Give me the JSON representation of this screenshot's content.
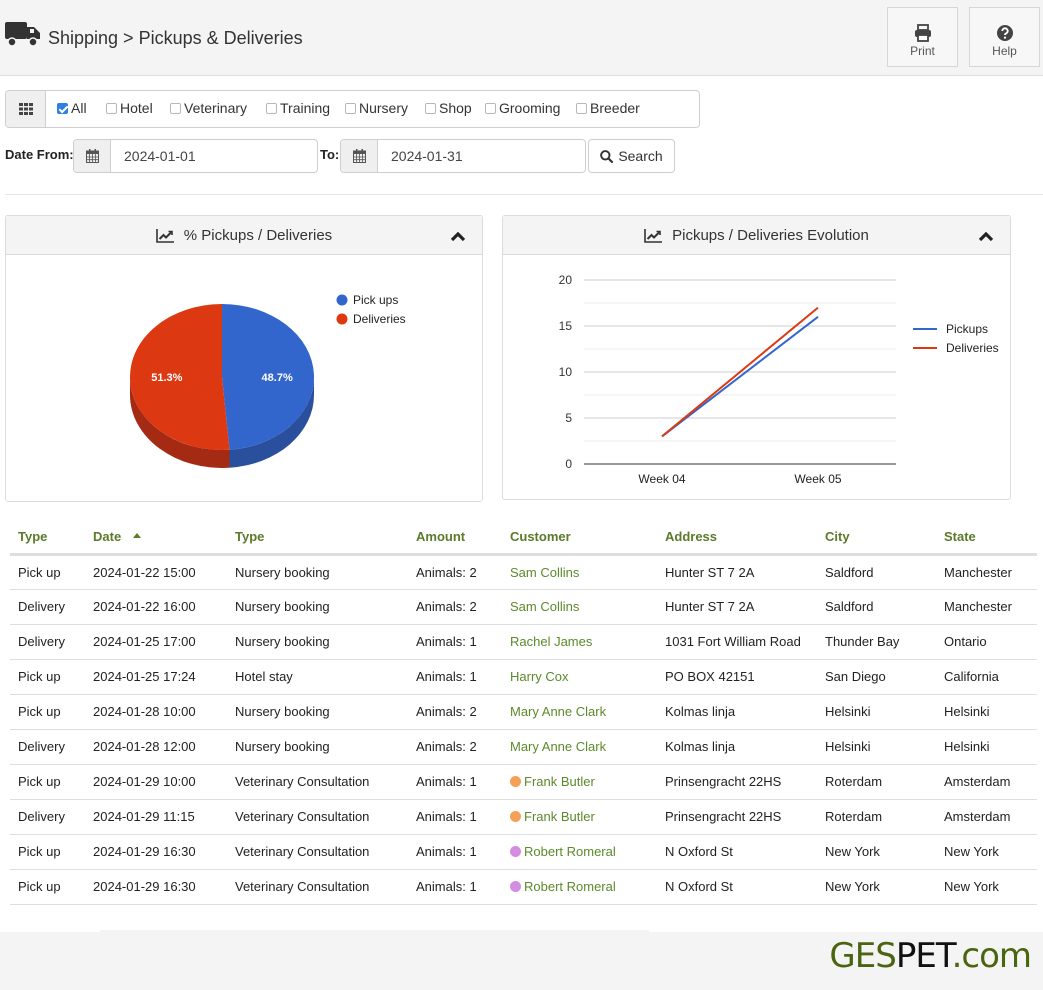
{
  "header": {
    "breadcrumb": "Shipping > Pickups & Deliveries",
    "icon": "truck-icon",
    "buttons": [
      {
        "label": "Print",
        "icon": "print-icon"
      },
      {
        "label": "Help",
        "icon": "question-circle-icon"
      }
    ]
  },
  "filters": {
    "categories": [
      {
        "label": "All",
        "checked": true
      },
      {
        "label": "Hotel",
        "checked": false
      },
      {
        "label": "Veterinary",
        "checked": false
      },
      {
        "label": "Training",
        "checked": false
      },
      {
        "label": "Nursery",
        "checked": false
      },
      {
        "label": "Shop",
        "checked": false
      },
      {
        "label": "Grooming",
        "checked": false
      },
      {
        "label": "Breeder",
        "checked": false
      }
    ],
    "date_from_label": "Date From:",
    "date_from": "2024-01-01",
    "date_to_label": "To:",
    "date_to": "2024-01-31",
    "search_label": "Search"
  },
  "colors": {
    "pickups": "#3366cc",
    "deliveries": "#dc3912",
    "header_green": "#5b7a2a",
    "link_green": "#5b8a2a"
  },
  "chart_data": [
    {
      "type": "pie",
      "title": "% Pickups / Deliveries",
      "labels": [
        "Pick ups",
        "Deliveries"
      ],
      "values": [
        48.7,
        51.3
      ],
      "data_labels": [
        "48.7%",
        "51.3%"
      ],
      "legend": "right"
    },
    {
      "type": "line",
      "title": "Pickups / Deliveries Evolution",
      "categories": [
        "Week 04",
        "Week 05"
      ],
      "series": [
        {
          "name": "Pickups",
          "values": [
            3,
            16
          ]
        },
        {
          "name": "Deliveries",
          "values": [
            3,
            17
          ]
        }
      ],
      "ylim": [
        0,
        20
      ],
      "yticks": [
        0,
        5,
        10,
        15,
        20
      ],
      "grid": true,
      "legend": "right"
    }
  ],
  "table": {
    "columns": [
      "Type",
      "Date",
      "Type",
      "Amount",
      "Customer",
      "Address",
      "City",
      "State"
    ],
    "sorted_column": "Date",
    "rows": [
      {
        "kind": "Pick up",
        "date": "2024-01-22 15:00",
        "service": "Nursery booking",
        "amount": "Animals: 2",
        "customer": "Sam Collins",
        "dot": "",
        "address": "Hunter ST 7 2A",
        "city": "Saldford",
        "state": "Manchester"
      },
      {
        "kind": "Delivery",
        "date": "2024-01-22 16:00",
        "service": "Nursery booking",
        "amount": "Animals: 2",
        "customer": "Sam Collins",
        "dot": "",
        "address": "Hunter ST 7 2A",
        "city": "Saldford",
        "state": "Manchester"
      },
      {
        "kind": "Delivery",
        "date": "2024-01-25 17:00",
        "service": "Nursery booking",
        "amount": "Animals: 1",
        "customer": "Rachel James",
        "dot": "",
        "address": "1031 Fort William Road",
        "city": "Thunder Bay",
        "state": "Ontario"
      },
      {
        "kind": "Pick up",
        "date": "2024-01-25 17:24",
        "service": "Hotel stay",
        "amount": "Animals: 1",
        "customer": "Harry Cox",
        "dot": "",
        "address": "PO BOX 42151",
        "city": "San Diego",
        "state": "California"
      },
      {
        "kind": "Pick up",
        "date": "2024-01-28 10:00",
        "service": "Nursery booking",
        "amount": "Animals: 2",
        "customer": "Mary Anne Clark",
        "dot": "",
        "address": "Kolmas linja",
        "city": "Helsinki",
        "state": "Helsinki"
      },
      {
        "kind": "Delivery",
        "date": "2024-01-28 12:00",
        "service": "Nursery booking",
        "amount": "Animals: 2",
        "customer": "Mary Anne Clark",
        "dot": "",
        "address": "Kolmas linja",
        "city": "Helsinki",
        "state": "Helsinki"
      },
      {
        "kind": "Pick up",
        "date": "2024-01-29 10:00",
        "service": "Veterinary Consultation",
        "amount": "Animals: 1",
        "customer": "Frank Butler",
        "dot": "#f4a057",
        "address": "Prinsengracht 22HS",
        "city": "Roterdam",
        "state": "Amsterdam"
      },
      {
        "kind": "Delivery",
        "date": "2024-01-29 11:15",
        "service": "Veterinary Consultation",
        "amount": "Animals: 1",
        "customer": "Frank Butler",
        "dot": "#f4a057",
        "address": "Prinsengracht 22HS",
        "city": "Roterdam",
        "state": "Amsterdam"
      },
      {
        "kind": "Pick up",
        "date": "2024-01-29 16:30",
        "service": "Veterinary Consultation",
        "amount": "Animals: 1",
        "customer": "Robert Romeral",
        "dot": "#d48ee0",
        "address": "N Oxford St",
        "city": "New York",
        "state": "New York"
      },
      {
        "kind": "Pick up",
        "date": "2024-01-29 16:30",
        "service": "Veterinary Consultation",
        "amount": "Animals: 1",
        "customer": "Robert Romeral",
        "dot": "#d48ee0",
        "address": "N Oxford St",
        "city": "New York",
        "state": "New York"
      }
    ]
  },
  "footer": {
    "brand_part1": "GES",
    "brand_part2": "PET",
    "brand_part3": ".com"
  }
}
